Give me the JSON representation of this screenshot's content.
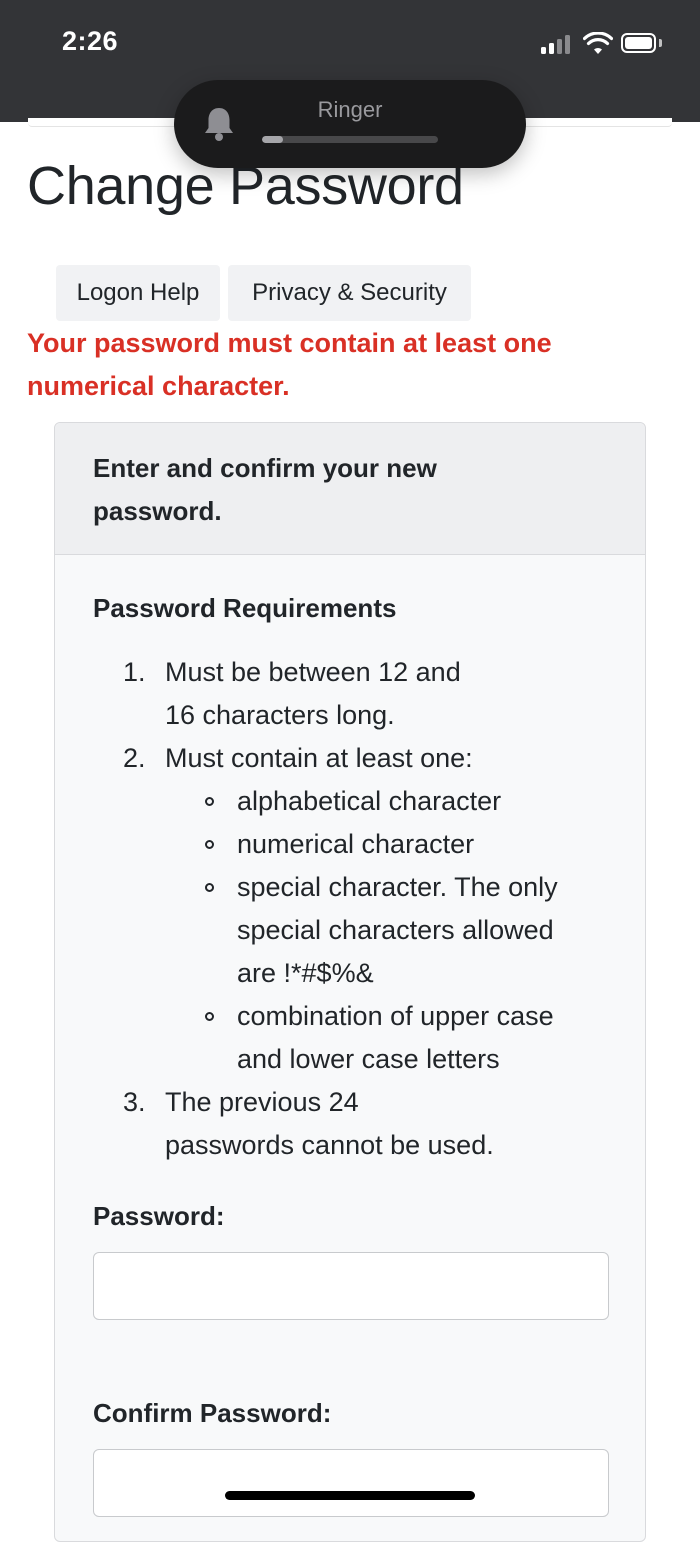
{
  "status_bar": {
    "time": "2:26",
    "icons": [
      "cellular-signal-icon",
      "wifi-icon",
      "battery-icon"
    ]
  },
  "ringer_hud": {
    "label": "Ringer",
    "icon": "bell-icon",
    "volume_level": 0.12
  },
  "page": {
    "title": "Change Password"
  },
  "nav": {
    "logon_help": "Logon Help",
    "privacy_security": "Privacy & Security"
  },
  "error": {
    "message": "Your password must contain at least one numerical character.",
    "color": "#d93025"
  },
  "card": {
    "header": "Enter and confirm your new password.",
    "requirements_title": "Password Requirements",
    "requirements": [
      {
        "num": "1.",
        "text": "Must be between 12 and 16 characters long."
      },
      {
        "num": "2.",
        "text": "Must contain at least one:",
        "sub": [
          "alphabetical character",
          "numerical character",
          "special character. The only special characters allowed are !*#$%&",
          "combination of upper case and lower case letters"
        ]
      },
      {
        "num": "3.",
        "text": "The previous 24 passwords cannot be used."
      }
    ],
    "password_label": "Password:",
    "password_value": "",
    "confirm_label": "Confirm Password:",
    "confirm_value": ""
  }
}
